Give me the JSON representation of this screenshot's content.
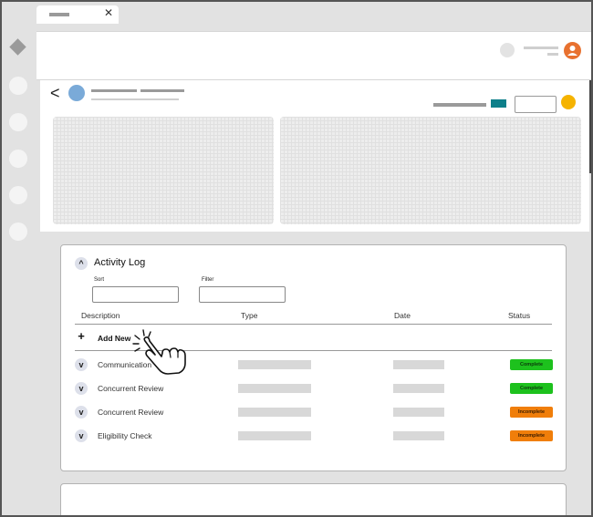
{
  "browser": {
    "tab_close_glyph": "✕"
  },
  "nav": {
    "icons": [
      "diamond-icon",
      "nav-circle-icon",
      "nav-circle-icon",
      "nav-circle-icon",
      "nav-circle-icon",
      "nav-circle-icon"
    ]
  },
  "header": {
    "avatar_icon": "user-icon"
  },
  "subheader": {
    "back_glyph": "<",
    "accent_colors": {
      "teal": "#0d7f8a",
      "yellow": "#f5b300",
      "avatar": "#e8712f",
      "profile": "#7aaad8"
    }
  },
  "activity_log": {
    "title": "Activity Log",
    "collapse_glyph": "^",
    "sort_label": "Sort",
    "filter_label": "Filter",
    "columns": {
      "description": "Description",
      "type": "Type",
      "date": "Date",
      "status": "Status"
    },
    "add_new_label": "Add New",
    "add_new_glyph": "+",
    "rows": [
      {
        "description": "Communication",
        "status": "Complete",
        "status_kind": "complete"
      },
      {
        "description": "Concurrent Review",
        "status": "Complete",
        "status_kind": "complete"
      },
      {
        "description": "Concurrent Review",
        "status": "Incomplete",
        "status_kind": "incomplete"
      },
      {
        "description": "Eligibility Check",
        "status": "Incomplete",
        "status_kind": "incomplete"
      }
    ],
    "row_expand_glyph": "v",
    "status_colors": {
      "complete": "#1dc11d",
      "incomplete": "#f07e0a"
    }
  }
}
